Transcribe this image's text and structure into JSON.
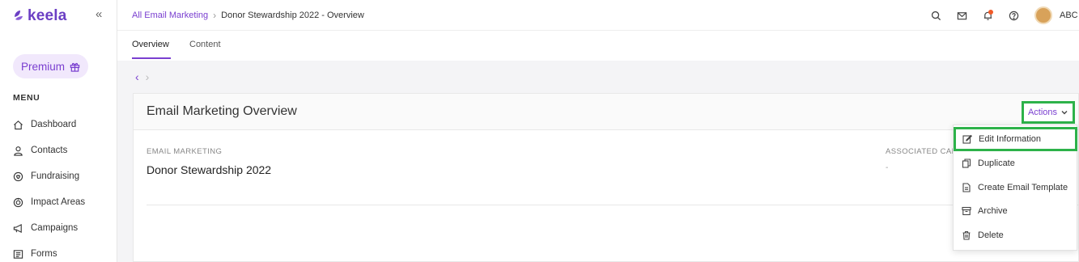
{
  "brand": {
    "name": "keela",
    "color": "#6b3fc4"
  },
  "sidebar": {
    "collapse_icon": "«",
    "premium_label": "Premium",
    "menu_title": "MENU",
    "items": [
      {
        "label": "Dashboard",
        "icon": "home-icon"
      },
      {
        "label": "Contacts",
        "icon": "user-icon"
      },
      {
        "label": "Fundraising",
        "icon": "donation-icon"
      },
      {
        "label": "Impact Areas",
        "icon": "target-icon"
      },
      {
        "label": "Campaigns",
        "icon": "megaphone-icon"
      },
      {
        "label": "Forms",
        "icon": "form-icon"
      }
    ]
  },
  "header": {
    "breadcrumb_parent": "All Email Marketing",
    "breadcrumb_current": "Donor Stewardship 2022 - Overview",
    "user_initials": "ABC"
  },
  "tabs": [
    {
      "label": "Overview",
      "active": true
    },
    {
      "label": "Content",
      "active": false
    }
  ],
  "card": {
    "title": "Email Marketing Overview",
    "actions_label": "Actions",
    "email_label": "EMAIL MARKETING",
    "email_value": "Donor Stewardship 2022",
    "assoc_label": "ASSOCIATED CAM",
    "assoc_value": "-"
  },
  "actions_menu": [
    {
      "label": "Edit Information",
      "icon": "edit-icon"
    },
    {
      "label": "Duplicate",
      "icon": "copy-icon"
    },
    {
      "label": "Create Email Template",
      "icon": "document-icon"
    },
    {
      "label": "Archive",
      "icon": "archive-icon"
    },
    {
      "label": "Delete",
      "icon": "trash-icon"
    }
  ],
  "colors": {
    "accent": "#7a3fd0",
    "highlight": "#2db24a",
    "notification": "#f05a28"
  }
}
